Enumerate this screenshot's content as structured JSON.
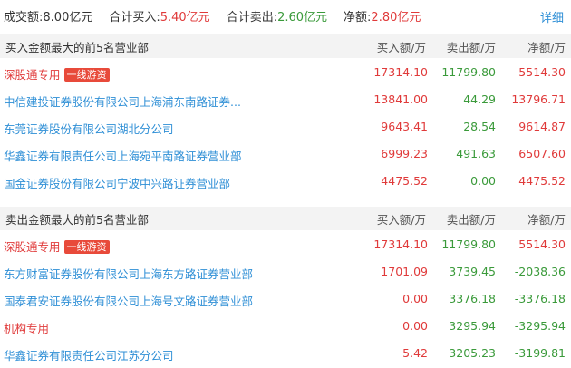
{
  "summary": {
    "turnover_label": "成交额:",
    "turnover_value": "8.00亿元",
    "buy_label": "合计买入:",
    "buy_value": "5.40亿元",
    "sell_label": "合计卖出:",
    "sell_value": "2.60亿元",
    "net_label": "净额:",
    "net_value": "2.80亿元",
    "detail_link": "详细"
  },
  "buy_section": {
    "title": "买入金额最大的前5名营业部",
    "col_buy": "买入额/万",
    "col_sell": "卖出额/万",
    "col_net": "净额/万",
    "rows": [
      {
        "name": "深股通专用",
        "tag": "一线游资",
        "buy": "17314.10",
        "sell": "11799.80",
        "net": "5514.30"
      },
      {
        "name": "中信建投证券股份有限公司上海浦东南路证券...",
        "tag": "",
        "buy": "13841.00",
        "sell": "44.29",
        "net": "13796.71"
      },
      {
        "name": "东莞证券股份有限公司湖北分公司",
        "tag": "",
        "buy": "9643.41",
        "sell": "28.54",
        "net": "9614.87"
      },
      {
        "name": "华鑫证券有限责任公司上海宛平南路证券营业部",
        "tag": "",
        "buy": "6999.23",
        "sell": "491.63",
        "net": "6507.60"
      },
      {
        "name": "国金证券股份有限公司宁波中兴路证券营业部",
        "tag": "",
        "buy": "4475.52",
        "sell": "0.00",
        "net": "4475.52"
      }
    ]
  },
  "sell_section": {
    "title": "卖出金额最大的前5名营业部",
    "col_buy": "买入额/万",
    "col_sell": "卖出额/万",
    "col_net": "净额/万",
    "rows": [
      {
        "name": "深股通专用",
        "tag": "一线游资",
        "buy": "17314.10",
        "sell": "11799.80",
        "net": "5514.30"
      },
      {
        "name": "东方财富证券股份有限公司上海东方路证券营业部",
        "tag": "",
        "buy": "1701.09",
        "sell": "3739.45",
        "net": "-2038.36"
      },
      {
        "name": "国泰君安证券股份有限公司上海号文路证券营业部",
        "tag": "",
        "buy": "0.00",
        "sell": "3376.18",
        "net": "-3376.18"
      },
      {
        "name": "机构专用",
        "tag": "",
        "buy": "0.00",
        "sell": "3295.94",
        "net": "-3295.94"
      },
      {
        "name": "华鑫证券有限责任公司江苏分公司",
        "tag": "",
        "buy": "5.42",
        "sell": "3205.23",
        "net": "-3199.81"
      }
    ]
  }
}
